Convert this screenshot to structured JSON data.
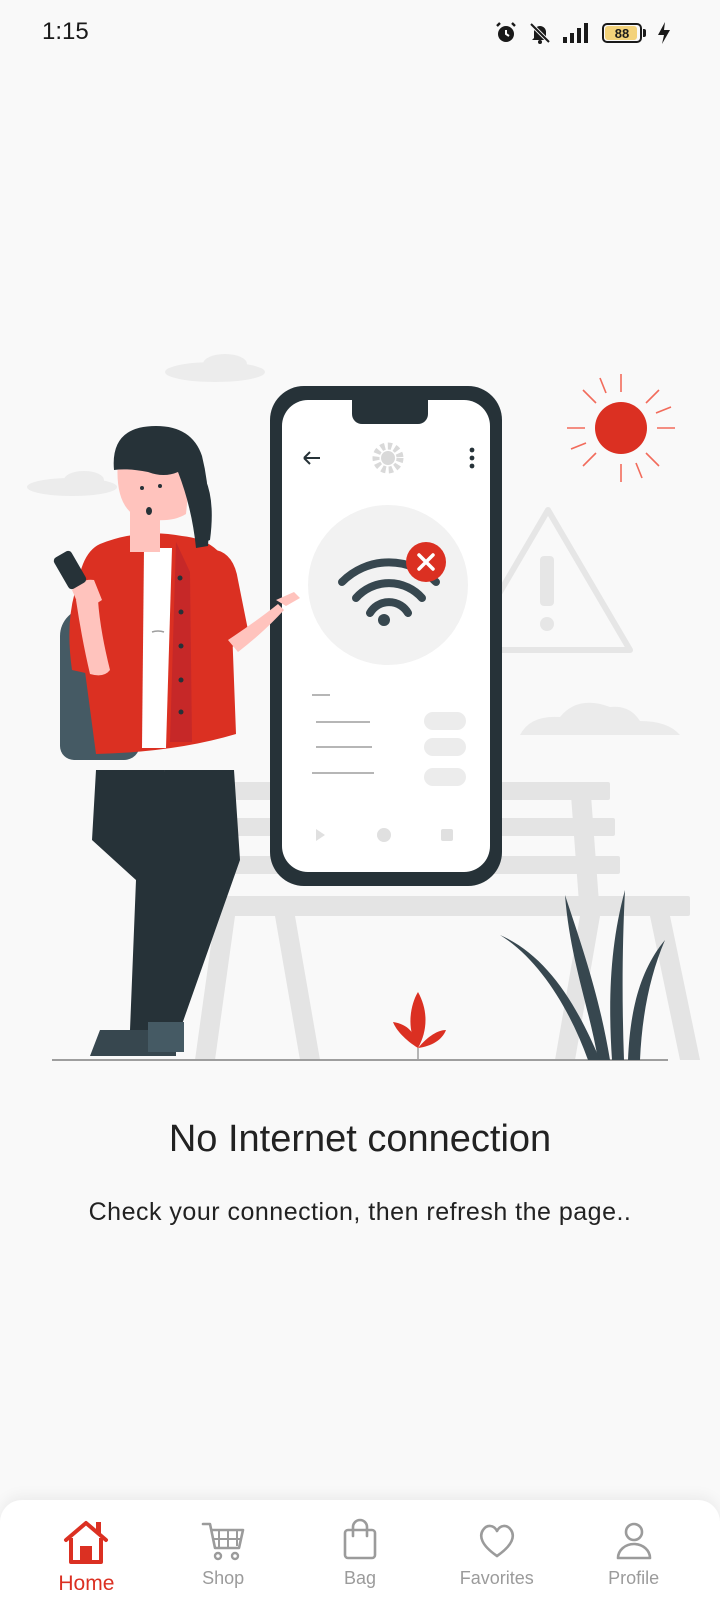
{
  "status_bar": {
    "time": "1:15",
    "battery_level": "88",
    "icons": [
      "alarm-icon",
      "bell-off-icon",
      "signal-icon",
      "battery-icon",
      "charging-icon"
    ]
  },
  "colors": {
    "accent": "#db3022",
    "dark": "#263238",
    "background": "#f9f9f9",
    "inactive": "#9b9b9b"
  },
  "message": {
    "title": "No Internet connection",
    "subtitle": "Check your connection, then refresh the page.."
  },
  "bottom_nav": {
    "items": [
      {
        "label": "Home",
        "icon": "home-icon",
        "active": true
      },
      {
        "label": "Shop",
        "icon": "cart-icon",
        "active": false
      },
      {
        "label": "Bag",
        "icon": "bag-icon",
        "active": false
      },
      {
        "label": "Favorites",
        "icon": "heart-icon",
        "active": false
      },
      {
        "label": "Profile",
        "icon": "profile-icon",
        "active": false
      }
    ]
  }
}
